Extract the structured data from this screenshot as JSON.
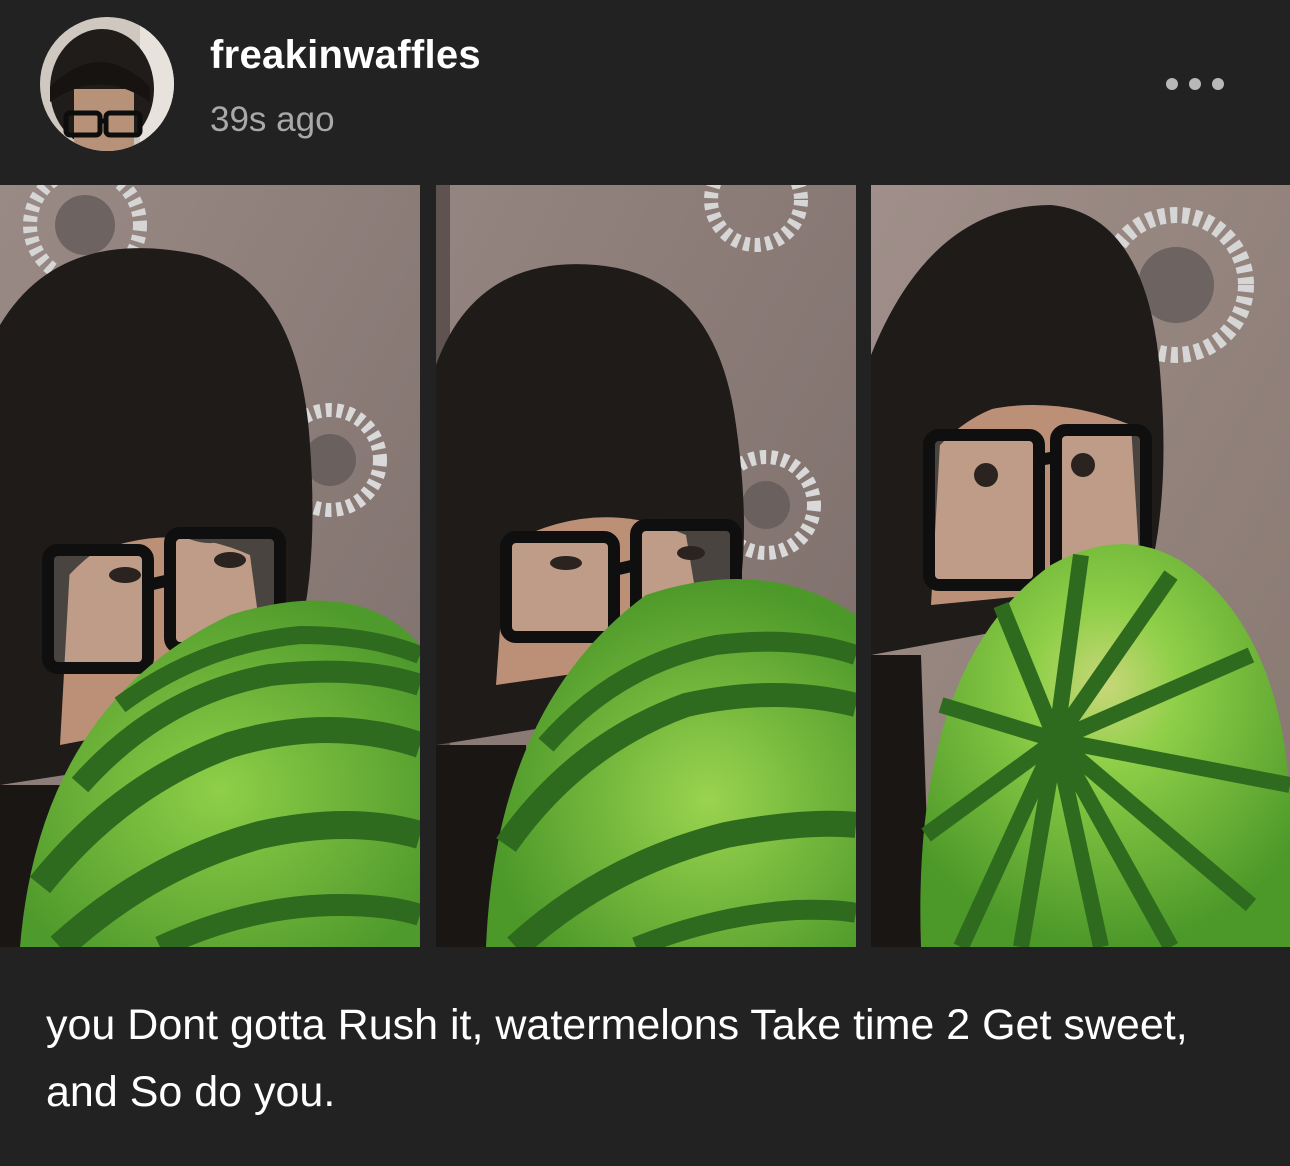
{
  "post": {
    "author": {
      "username": "freakinwaffles",
      "timestamp": "39s ago",
      "avatar_icon": "avatar-photo"
    },
    "more_icon": "more-dots-icon",
    "photos": [
      {
        "name": "photo-1",
        "description_icon": "watermelon-selfie"
      },
      {
        "name": "photo-2",
        "description_icon": "watermelon-selfie"
      },
      {
        "name": "photo-3",
        "description_icon": "watermelon-selfie"
      }
    ],
    "caption": "you Dont gotta Rush it, watermelons Take time 2 Get sweet, and So do you."
  },
  "colors": {
    "background": "#222222",
    "text": "#ffffff",
    "muted": "#a9a9a9",
    "wall": "#8c7d79",
    "hair": "#1d1a17",
    "melon_light": "#7fbf3a",
    "melon_dark": "#2f6b1e"
  }
}
